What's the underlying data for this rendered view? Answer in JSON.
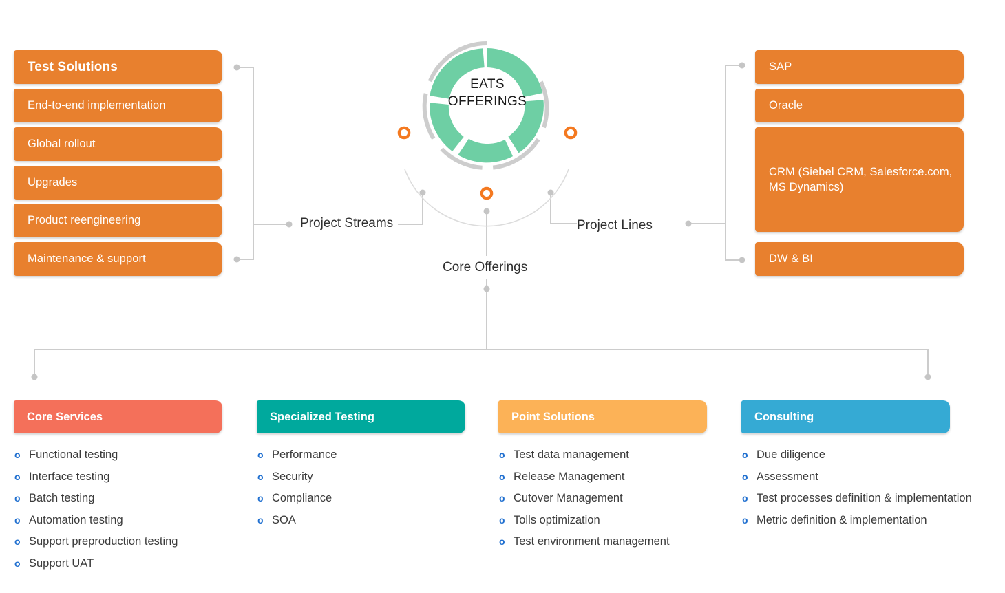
{
  "center": {
    "title_line1": "EATS",
    "title_line2": "OFFERINGS",
    "segment_color": "#6ECFA4",
    "ring_color": "#cfcfcf",
    "marker_color": "#F47920"
  },
  "connector_labels": {
    "project_streams": "Project Streams",
    "project_lines": "Project Lines",
    "core_offerings": "Core Offerings"
  },
  "project_streams": {
    "color": "#E8802E",
    "items": [
      {
        "label": "Test Solutions",
        "bold": true
      },
      {
        "label": "End-to-end implementation",
        "bold": false
      },
      {
        "label": "Global rollout",
        "bold": false
      },
      {
        "label": "Upgrades",
        "bold": false
      },
      {
        "label": "Product reengineering",
        "bold": false
      },
      {
        "label": "Maintenance & support",
        "bold": false
      }
    ]
  },
  "project_lines": {
    "color": "#E8802E",
    "items": [
      {
        "label": "SAP"
      },
      {
        "label": "Oracle"
      },
      {
        "label": "CRM (Siebel CRM, Salesforce.com, MS Dynamics)"
      },
      {
        "label": "DW & BI"
      }
    ]
  },
  "core_offerings": {
    "columns": [
      {
        "title": "Core Services",
        "color": "#F4705A",
        "items": [
          "Functional testing",
          "Interface testing",
          "Batch testing",
          "Automation testing",
          "Support preproduction testing",
          "Support UAT"
        ]
      },
      {
        "title": "Specialized Testing",
        "color": "#00A99D",
        "items": [
          "Performance",
          "Security",
          "Compliance",
          "SOA"
        ]
      },
      {
        "title": "Point Solutions",
        "color": "#FCB257",
        "items": [
          "Test data management",
          "Release Management",
          "Cutover Management",
          "Tolls optimization",
          "Test environment management"
        ]
      },
      {
        "title": "Consulting",
        "color": "#35AAD4",
        "items": [
          "Due diligence",
          "Assessment",
          "Test processes definition & implementation",
          "Metric definition & implementation"
        ]
      }
    ]
  },
  "bullet_glyph": "o"
}
